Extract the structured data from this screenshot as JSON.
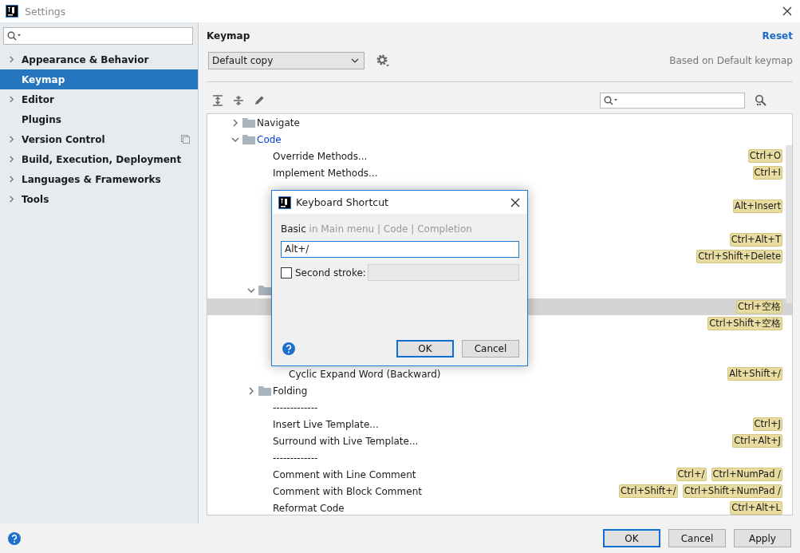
{
  "window": {
    "title": "Settings"
  },
  "sidebar": {
    "items": [
      {
        "label": "Appearance & Behavior",
        "expandable": true,
        "selected": false,
        "project_level": false
      },
      {
        "label": "Keymap",
        "expandable": false,
        "selected": true,
        "project_level": false
      },
      {
        "label": "Editor",
        "expandable": true,
        "selected": false,
        "project_level": false
      },
      {
        "label": "Plugins",
        "expandable": false,
        "selected": false,
        "project_level": false
      },
      {
        "label": "Version Control",
        "expandable": true,
        "selected": false,
        "project_level": true
      },
      {
        "label": "Build, Execution, Deployment",
        "expandable": true,
        "selected": false,
        "project_level": false
      },
      {
        "label": "Languages & Frameworks",
        "expandable": true,
        "selected": false,
        "project_level": false
      },
      {
        "label": "Tools",
        "expandable": true,
        "selected": false,
        "project_level": false
      }
    ]
  },
  "keymap": {
    "title": "Keymap",
    "reset": "Reset",
    "scheme": "Default copy",
    "based_on": "Based on Default keymap",
    "tree": [
      {
        "kind": "folder",
        "label": "Navigate",
        "expanded": false,
        "modified": false,
        "selected": false
      },
      {
        "kind": "folder",
        "label": "Code",
        "expanded": true,
        "modified": true,
        "selected": false,
        "children": [
          {
            "kind": "action",
            "label": "Override Methods...",
            "shortcuts": [
              "Ctrl+O"
            ],
            "selected": false
          },
          {
            "kind": "action",
            "label": "Implement Methods...",
            "shortcuts": [
              "Ctrl+I"
            ],
            "selected": false
          },
          {
            "kind": "blank"
          },
          {
            "kind": "action",
            "shortcuts": [
              "Alt+Insert"
            ],
            "selected": false
          },
          {
            "kind": "blank"
          },
          {
            "kind": "action",
            "shortcuts": [
              "Ctrl+Alt+T"
            ],
            "selected": false
          },
          {
            "kind": "action",
            "shortcuts": [
              "Ctrl+Shift+Delete"
            ],
            "selected": false
          },
          {
            "kind": "blank"
          },
          {
            "kind": "folder",
            "expanded": true,
            "modified": false,
            "selected": false,
            "children": [
              {
                "kind": "action",
                "shortcuts": [
                  "Ctrl+空格"
                ],
                "selected": true
              },
              {
                "kind": "action",
                "shortcuts": [
                  "Ctrl+Shift+空格"
                ],
                "selected": false
              },
              {
                "kind": "blank"
              },
              {
                "kind": "blank"
              },
              {
                "kind": "action",
                "label": "Cyclic Expand Word (Backward)",
                "shortcuts": [
                  "Alt+Shift+/"
                ],
                "selected": false
              }
            ]
          },
          {
            "kind": "folder",
            "label": "Folding",
            "expanded": false,
            "modified": false,
            "selected": false
          },
          {
            "kind": "action",
            "label": "-------------",
            "selected": false
          },
          {
            "kind": "action",
            "label": "Insert Live Template...",
            "shortcuts": [
              "Ctrl+J"
            ],
            "selected": false
          },
          {
            "kind": "action",
            "label": "Surround with Live Template...",
            "shortcuts": [
              "Ctrl+Alt+J"
            ],
            "selected": false
          },
          {
            "kind": "action",
            "label": "-------------",
            "selected": false
          },
          {
            "kind": "action",
            "label": "Comment with Line Comment",
            "shortcuts": [
              "Ctrl+/",
              "Ctrl+NumPad /"
            ],
            "selected": false
          },
          {
            "kind": "action",
            "label": "Comment with Block Comment",
            "shortcuts": [
              "Ctrl+Shift+/",
              "Ctrl+Shift+NumPad /"
            ],
            "selected": false
          },
          {
            "kind": "action",
            "label": "Reformat Code",
            "shortcuts": [
              "Ctrl+Alt+L"
            ],
            "selected": false
          }
        ]
      }
    ]
  },
  "dialog": {
    "title": "Keyboard Shortcut",
    "action": "Basic",
    "location": "in Main menu | Code | Completion",
    "first_stroke": "Alt+/",
    "second_stroke": {
      "label": "Second stroke:",
      "checked": false
    },
    "buttons": [
      {
        "label": "OK",
        "default": true
      },
      {
        "label": "Cancel",
        "default": false
      }
    ]
  },
  "buttons": [
    {
      "label": "OK",
      "default": true
    },
    {
      "label": "Cancel",
      "default": false
    },
    {
      "label": "Apply",
      "default": false
    }
  ]
}
